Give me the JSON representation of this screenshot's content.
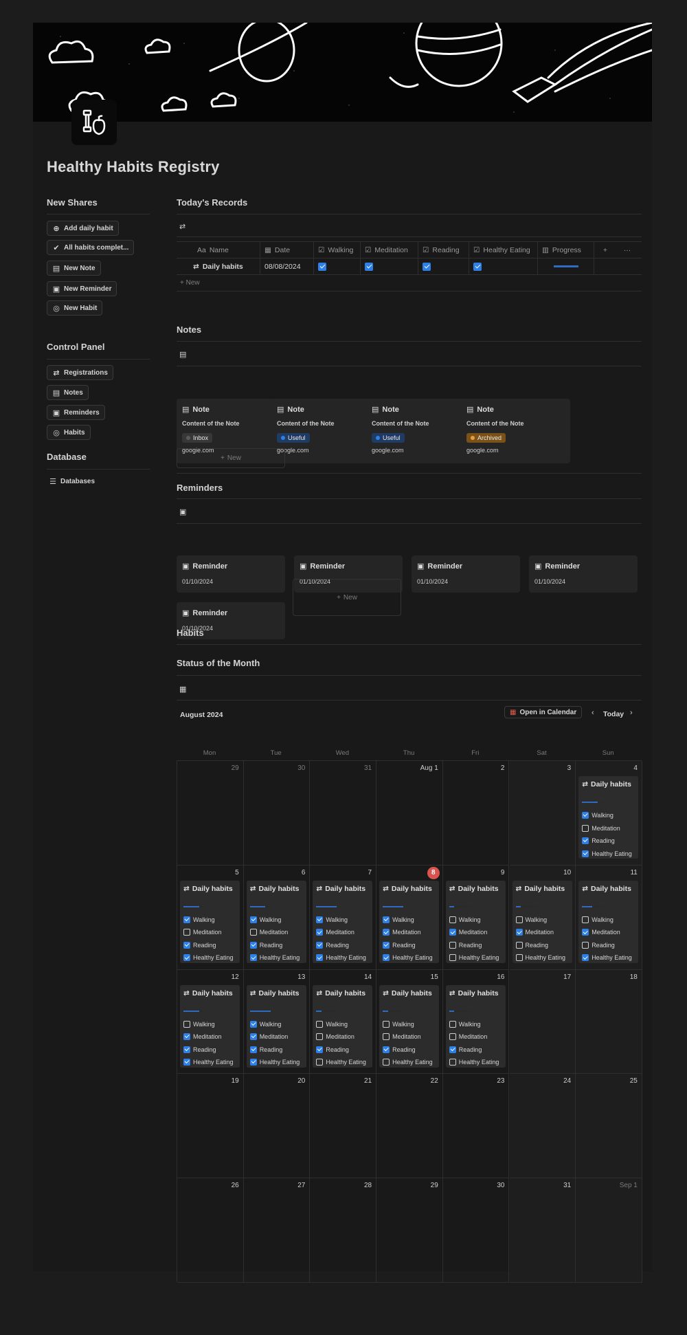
{
  "page": {
    "title": "Healthy Habits Registry"
  },
  "sidebar": {
    "new_shares": {
      "heading": "New Shares",
      "buttons": [
        "Add daily habit",
        "All habits complet...",
        "New Note",
        "New Reminder",
        "New Habit"
      ]
    },
    "control_panel": {
      "heading": "Control Panel",
      "buttons": [
        "Registrations",
        "Notes",
        "Reminders",
        "Habits"
      ]
    },
    "database": {
      "heading": "Database",
      "buttons": [
        "Databases"
      ]
    }
  },
  "todays_records": {
    "heading": "Today's Records",
    "columns": [
      "Name",
      "Date",
      "Walking",
      "Meditation",
      "Reading",
      "Healthy Eating",
      "Progress"
    ],
    "column_prefix": "Aa",
    "add_column": "+",
    "more": "···",
    "rows": [
      {
        "name": "Daily habits",
        "date": "08/08/2024",
        "walking": true,
        "meditation": true,
        "reading": true,
        "healthy_eating": true,
        "progress": 1.0
      }
    ],
    "new_label": "+ New"
  },
  "notes": {
    "heading": "Notes",
    "cards": [
      {
        "title": "Note",
        "content": "Content of the Note",
        "tag": "Inbox",
        "tag_color": "#5a5a5a",
        "tag_bg": "#373737",
        "url": "google.com"
      },
      {
        "title": "Note",
        "content": "Content of the Note",
        "tag": "Useful",
        "tag_color": "#2f80e6",
        "tag_bg": "#1f3b63",
        "url": "google.com"
      },
      {
        "title": "Note",
        "content": "Content of the Note",
        "tag": "Useful",
        "tag_color": "#2f80e6",
        "tag_bg": "#1f3b63",
        "url": "google.com"
      },
      {
        "title": "Note",
        "content": "Content of the Note",
        "tag": "Archived",
        "tag_color": "#e0a040",
        "tag_bg": "#7a5218",
        "url": "google.com"
      }
    ],
    "new_label": "New"
  },
  "reminders": {
    "heading": "Reminders",
    "cards": [
      {
        "title": "Reminder",
        "date": "01/10/2024"
      },
      {
        "title": "Reminder",
        "date": "01/10/2024"
      },
      {
        "title": "Reminder",
        "date": "01/10/2024"
      },
      {
        "title": "Reminder",
        "date": "01/10/2024"
      },
      {
        "title": "Reminder",
        "date": "01/10/2024"
      }
    ],
    "new_label": "New"
  },
  "habits": {
    "heading": "Habits"
  },
  "calendar": {
    "heading": "Status of the Month",
    "month": "August 2024",
    "open_in_calendar": "Open in Calendar",
    "today": "Today",
    "weekdays": [
      "Mon",
      "Tue",
      "Wed",
      "Thu",
      "Fri",
      "Sat",
      "Sun"
    ],
    "weeks": [
      [
        "29",
        "30",
        "31",
        "Aug 1",
        "2",
        "3",
        "4"
      ],
      [
        "5",
        "6",
        "7",
        "8",
        "9",
        "10",
        "11"
      ],
      [
        "12",
        "13",
        "14",
        "15",
        "16",
        "17",
        "18"
      ],
      [
        "19",
        "20",
        "21",
        "22",
        "23",
        "24",
        "25"
      ],
      [
        "26",
        "27",
        "28",
        "29",
        "30",
        "31",
        "Sep 1"
      ]
    ],
    "today_cell": "8",
    "event_title": "Daily habits",
    "habit_labels": [
      "Walking",
      "Meditation",
      "Reading",
      "Healthy Eating"
    ],
    "events": {
      "0-6": [
        true,
        false,
        true,
        true
      ],
      "1-0": [
        true,
        false,
        true,
        true
      ],
      "1-1": [
        true,
        false,
        true,
        true
      ],
      "1-2": [
        true,
        true,
        true,
        true
      ],
      "1-3": [
        true,
        true,
        true,
        true
      ],
      "1-4": [
        false,
        true,
        false,
        false
      ],
      "1-5": [
        false,
        true,
        false,
        false
      ],
      "1-6": [
        false,
        true,
        false,
        true
      ],
      "2-0": [
        false,
        true,
        true,
        true
      ],
      "2-1": [
        true,
        true,
        true,
        true
      ],
      "2-2": [
        false,
        false,
        true,
        false
      ],
      "2-3": [
        false,
        false,
        true,
        false
      ],
      "2-4": [
        false,
        false,
        true,
        false
      ]
    }
  }
}
